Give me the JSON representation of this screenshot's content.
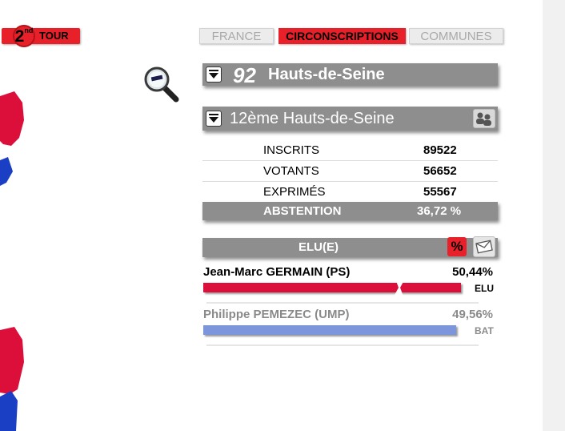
{
  "round": {
    "number": "2",
    "suffix": "nd",
    "label": "TOUR"
  },
  "tabs": [
    {
      "label": "FRANCE",
      "active": false
    },
    {
      "label": "CIRCONSCRIPTIONS",
      "active": true
    },
    {
      "label": "COMMUNES",
      "active": false
    }
  ],
  "department": {
    "number": "92",
    "name": "Hauts-de-Seine"
  },
  "circonscription": {
    "name": "12ème Hauts-de-Seine"
  },
  "stats": [
    {
      "label": "INSCRITS",
      "value": "89522"
    },
    {
      "label": "VOTANTS",
      "value": "56652"
    },
    {
      "label": "EXPRIMÉS",
      "value": "55567"
    }
  ],
  "abstention": {
    "label": "ABSTENTION",
    "value": "36,72 %"
  },
  "elected": {
    "title": "ELU(E)",
    "percent_button": "%"
  },
  "candidates": [
    {
      "name": "Jean-Marc GERMAIN  (PS)",
      "percent": "50,44%",
      "share": 50.44,
      "status": "ELU",
      "color": "#dc0f3b",
      "text_color": "#000000"
    },
    {
      "name": "Philippe PEMEZEC  (UMP)",
      "percent": "49,56%",
      "share": 49.56,
      "status": "BAT",
      "color": "#7d95db",
      "text_color": "#8a8a8a"
    }
  ],
  "colors": {
    "accent": "#e8202a",
    "header_grey": "#8e8e8e",
    "left_party": "#dc0f3b",
    "right_party": "#1a3fc4"
  },
  "icons": [
    "zoom-out-icon",
    "toggle-icon",
    "group-icon",
    "envelope-icon"
  ]
}
